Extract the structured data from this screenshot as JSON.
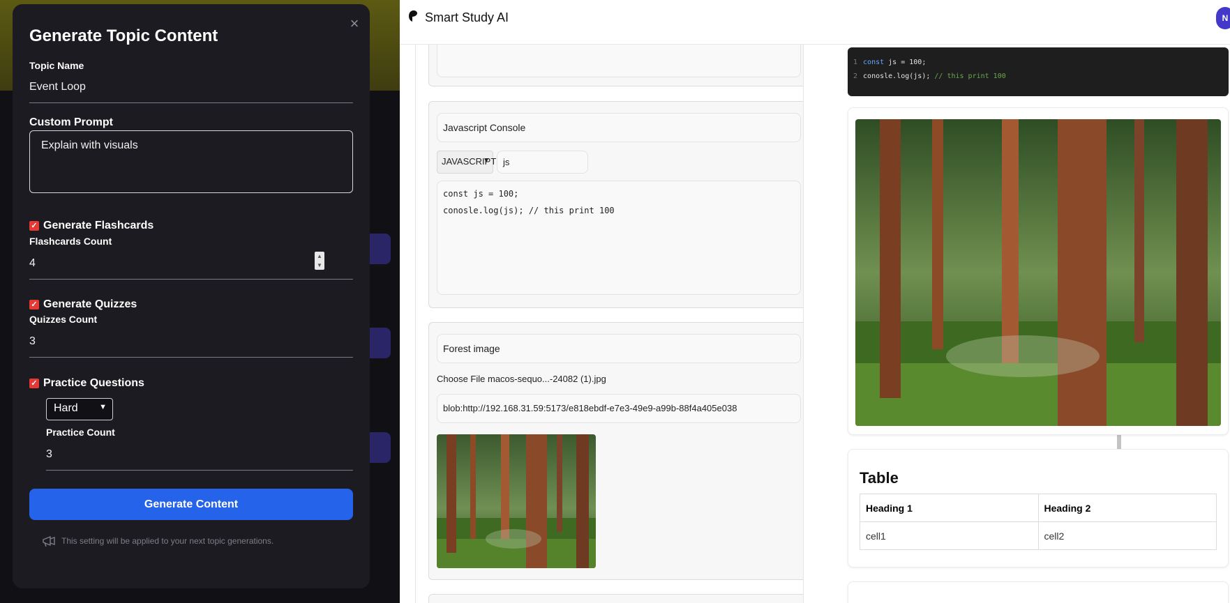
{
  "modal": {
    "title": "Generate Topic Content",
    "close_icon": "close-icon",
    "topic_name_label": "Topic Name",
    "topic_name_value": "Event Loop",
    "custom_prompt_label": "Custom Prompt",
    "custom_prompt_value": "Explain with visuals",
    "flashcards": {
      "label": "Generate Flashcards",
      "checked": true,
      "count_label": "Flashcards Count",
      "count_value": "4"
    },
    "quizzes": {
      "label": "Generate Quizzes",
      "checked": true,
      "count_label": "Quizzes Count",
      "count_value": "3"
    },
    "practice": {
      "label": "Practice Questions",
      "checked": true,
      "difficulty": "Hard",
      "count_label": "Practice Count",
      "count_value": "3"
    },
    "submit_label": "Generate Content",
    "note": "This setting will be applied to your next topic generations.",
    "accent": "#2563eb",
    "check_color": "#e53935"
  },
  "app": {
    "brand": "Smart Study AI",
    "avatar_initial": "N",
    "editor": {
      "code_block": {
        "title": "Javascript Console",
        "language": "JAVASCRIPT",
        "filename": "js",
        "code": "const js = 100;\nconosle.log(js); // this print 100"
      },
      "image_block": {
        "title": "Forest image",
        "file_button": "Choose File",
        "file_name": "macos-sequo...-24082 (1).jpg",
        "url": "blob:http://192.168.31.59:5173/e818ebdf-e7e3-49e9-a99b-88f4a405e038"
      }
    },
    "preview": {
      "code_lines": [
        {
          "num": "1",
          "kw": "const",
          "rest": " js = 100;",
          "comment": ""
        },
        {
          "num": "2",
          "kw": "",
          "rest": "conosle.log(js); ",
          "comment": "// this print 100"
        }
      ],
      "table": {
        "title": "Table",
        "headers": [
          "Heading 1",
          "Heading 2"
        ],
        "rows": [
          [
            "cell1",
            "cell2"
          ]
        ]
      }
    }
  }
}
